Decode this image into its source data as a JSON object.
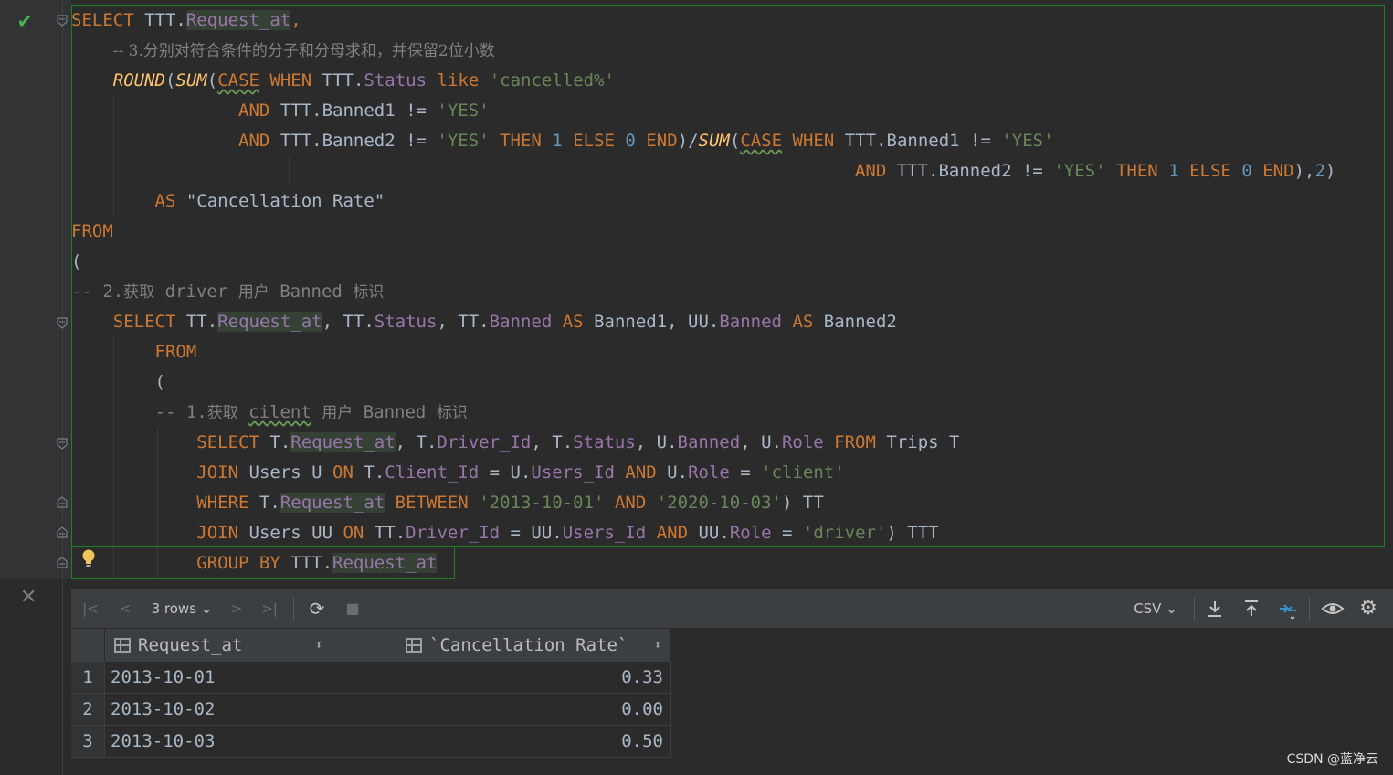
{
  "editor": {
    "l1": {
      "kw": "SELECT",
      "t": "TTT.",
      "f": "Request_at",
      "p": ","
    },
    "l2": {
      "cm": "-- 3.分别对符合条件的分子和分母求和，并保留2位小数"
    },
    "l3": {
      "fn1": "ROUND",
      "p1": "(",
      "fn2": "SUM",
      "p2": "(",
      "kw1": "CASE",
      "kw2": "WHEN",
      "t1": "TTT.",
      "f1": "Status",
      "kw3": "like",
      "s1": "'cancelled%'"
    },
    "l4": {
      "kw": "AND",
      "t": "TTT.Banned1 != ",
      "s": "'YES'"
    },
    "l5": {
      "kw1": "AND",
      "t1": "TTT.Banned2 != ",
      "s1": "'YES'",
      "kw2": "THEN",
      "n1": "1",
      "kw3": "ELSE",
      "n2": "0",
      "kw4": "END",
      "t2": ")/",
      "fn": "SUM",
      "p": "(",
      "kw5": "CASE",
      "kw6": "WHEN",
      "t3": "TTT.Banned1 != ",
      "s2": "'YES'"
    },
    "l6": {
      "kw1": "AND",
      "t1": "TTT.Banned2 != ",
      "s1": "'YES'",
      "kw2": "THEN",
      "n1": "1",
      "kw3": "ELSE",
      "n2": "0",
      "kw4": "END",
      "t2": "),",
      "n3": "2",
      "t3": ")"
    },
    "l7": {
      "kw": "AS",
      "t": "\"Cancellation Rate\""
    },
    "l8": {
      "kw": "FROM"
    },
    "l9": {
      "t": "("
    },
    "l10": {
      "cm1": "-- 2.",
      "cmz1": "获取",
      "cm2": "driver",
      "cmz2": "用户",
      "cm3": "Banned",
      "cmz3": "标识"
    },
    "l11": {
      "kw1": "SELECT",
      "t1": "TT.",
      "f1": "Request_at",
      "t2": ", TT.",
      "f2": "Status",
      "t3": ", TT.",
      "f3": "Banned",
      "kw2": "AS",
      "t4": "Banned1, UU.",
      "f4": "Banned",
      "kw3": "AS",
      "t5": "Banned2"
    },
    "l12": {
      "kw": "FROM"
    },
    "l13": {
      "t": "("
    },
    "l14": {
      "cm1": "-- 1.",
      "cmz1": "获取",
      "cm2": "cilent",
      "cmz2": "用户",
      "cm3": "Banned",
      "cmz3": "标识"
    },
    "l15": {
      "kw1": "SELECT",
      "t1": "T.",
      "f1": "Request_at",
      "t2": ", T.",
      "f2": "Driver_Id",
      "t3": ", T.",
      "f3": "Status",
      "t4": ", U.",
      "f4": "Banned",
      "t5": ", U.",
      "f5": "Role",
      "kw2": "FROM",
      "t6": "Trips T"
    },
    "l16": {
      "kw1": "JOIN",
      "t1": "Users U",
      "kw2": "ON",
      "t2": "T.",
      "f1": "Client_Id",
      "t3": " = U.",
      "f2": "Users_Id",
      "kw3": "AND",
      "t4": "U.",
      "f3": "Role",
      "t5": " = ",
      "s": "'client'"
    },
    "l17": {
      "kw1": "WHERE",
      "t1": "T.",
      "f1": "Request_at",
      "kw2": "BETWEEN",
      "s1": "'2013-10-01'",
      "kw3": "AND",
      "s2": "'2020-10-03'",
      "t2": ") TT"
    },
    "l18": {
      "kw1": "JOIN",
      "t1": "Users UU",
      "kw2": "ON",
      "t2": "TT.",
      "f1": "Driver_Id",
      "t3": " = UU.",
      "f2": "Users_Id",
      "kw3": "AND",
      "t4": "UU.",
      "f3": "Role",
      "t5": " = ",
      "s": "'driver'",
      "t6": ") TTT"
    },
    "l19": {
      "kw": "GROUP BY",
      "t": "TTT.",
      "f": "Request_at"
    }
  },
  "toolbar": {
    "rows_label": "3 rows",
    "export_format": "CSV"
  },
  "result": {
    "columns": [
      "Request_at",
      "`Cancellation Rate`"
    ],
    "rows": [
      {
        "n": "1",
        "date": "2013-10-01",
        "rate": "0.33"
      },
      {
        "n": "2",
        "date": "2013-10-02",
        "rate": "0.00"
      },
      {
        "n": "3",
        "date": "2013-10-03",
        "rate": "0.50"
      }
    ]
  },
  "watermark": "CSDN @蓝净云",
  "colors": {
    "keyword": "#cc7832",
    "string": "#6a8759",
    "number": "#6897bb",
    "field": "#9876aa",
    "comment": "#808080",
    "function": "#ffc66d",
    "success": "#4caf50"
  }
}
